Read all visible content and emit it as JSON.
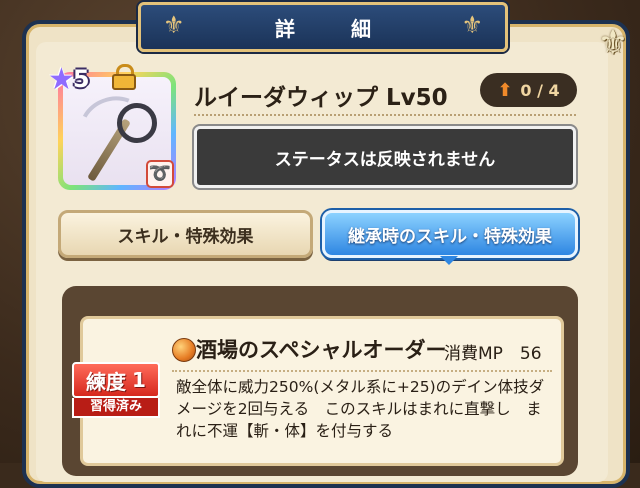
{
  "title": "詳　細",
  "item": {
    "name": "ルイーダウィップ Lv50",
    "rarity": "5",
    "upgrade": "0 / 4",
    "status_notice": "ステータスは反映されません"
  },
  "tabs": [
    {
      "label": "スキル・特殊効果"
    },
    {
      "label": "継承時のスキル・特殊効果"
    }
  ],
  "skill": {
    "name": "酒場のスペシャルオーダー",
    "mp": "消費MP　56",
    "rank_label": "練度",
    "rank_value": "1",
    "rank_status": "習得済み",
    "description": "敵全体に威力250%(メタル系に+25)のデイン体技ダメージを2回与える　このスキルはまれに直撃し　まれに不運【斬・体】を付与する"
  },
  "colors": {
    "frame_blue": "#1d3150",
    "active_tab": "#2e86e2",
    "badge_red": "#d6281e"
  }
}
